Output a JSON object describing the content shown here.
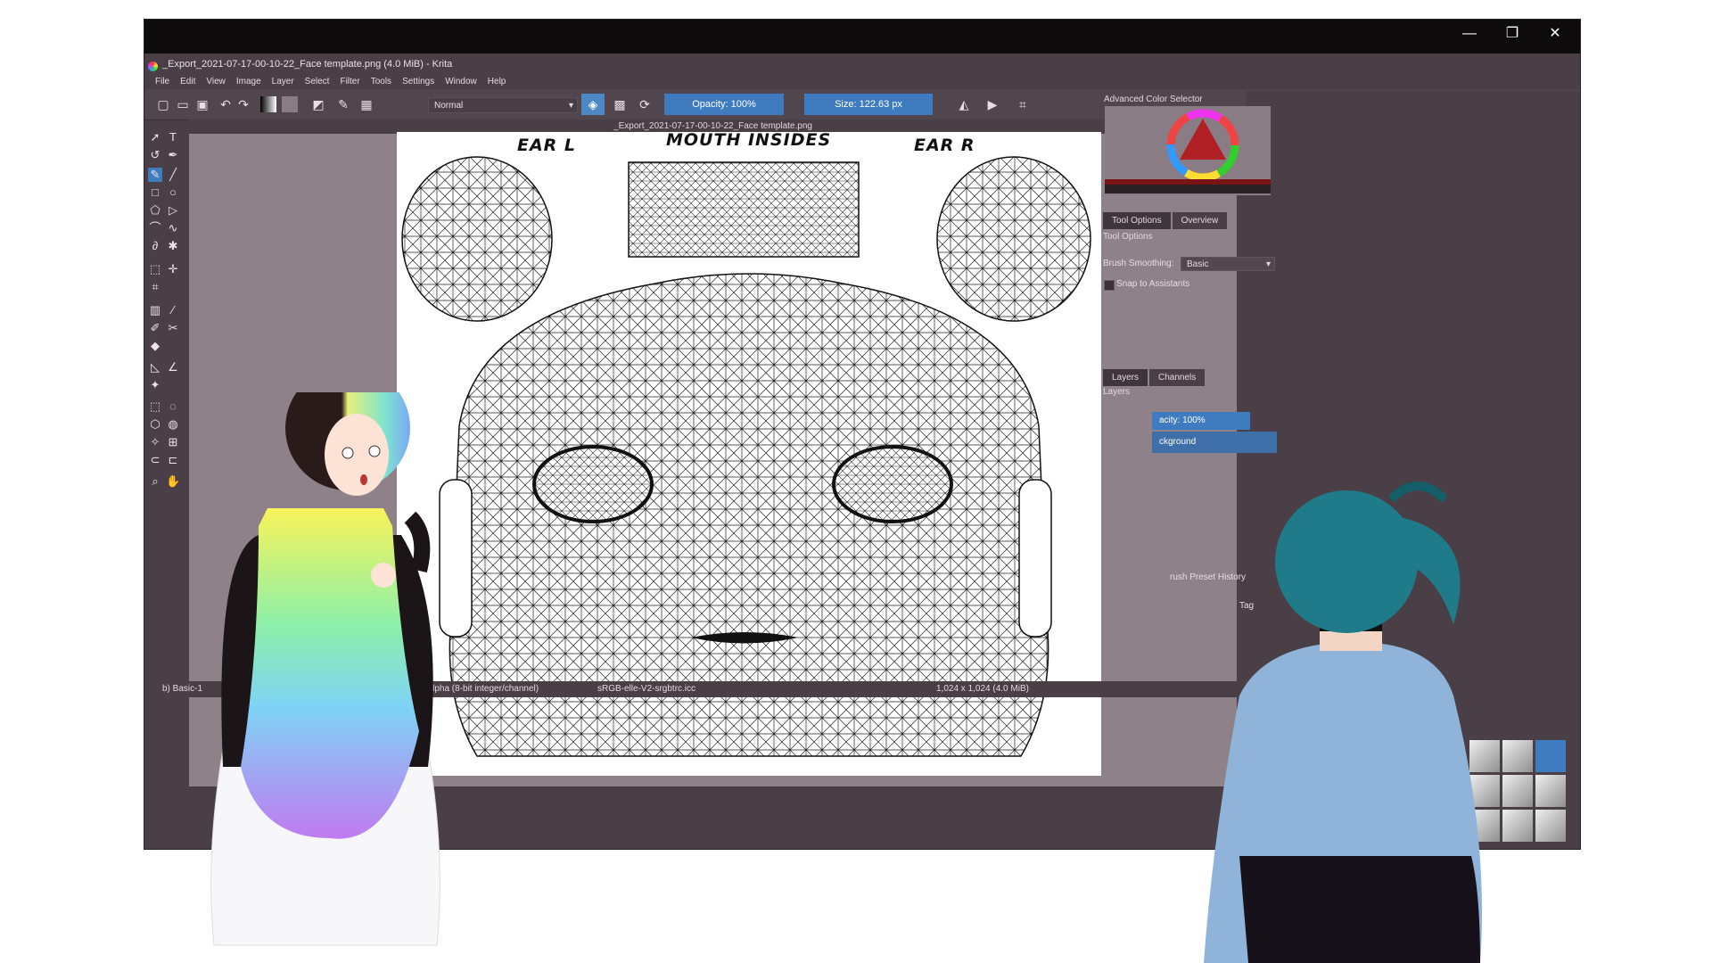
{
  "window": {
    "title": "_Export_2021-07-17-00-10-22_Face template.png (4.0 MiB) - Krita",
    "controls": [
      "—",
      "❐",
      "✕"
    ]
  },
  "menu": [
    "File",
    "Edit",
    "View",
    "Image",
    "Layer",
    "Select",
    "Filter",
    "Tools",
    "Settings",
    "Window",
    "Help"
  ],
  "toolbar": {
    "blend_mode": "Normal",
    "opacity": "Opacity: 100%",
    "size": "Size: 122.63 px"
  },
  "document": {
    "tab_title": "_Export_2021-07-17-00-10-22_Face template.png",
    "labels": [
      "EAR L",
      "MOUTH INSIDES",
      "EAR R"
    ]
  },
  "dock": {
    "color_selector_title": "Advanced Color Selector",
    "tabs_tool": [
      "Tool Options",
      "Overview"
    ],
    "tool_options_title": "Tool Options",
    "brush_smoothing_label": "Brush Smoothing:",
    "brush_smoothing_value": "Basic",
    "snap_label": "Snap to Assistants",
    "tabs_layers": [
      "Layers",
      "Channels"
    ],
    "layers_title": "Layers",
    "layer_opacity": "acity:  100%",
    "layer_name": "ckground",
    "preset_history": "rush Preset History",
    "tag_label": "Tag"
  },
  "status": {
    "brush": "b) Basic-1",
    "color_space": "RGB/Alpha (8-bit integer/channel)",
    "profile": "sRGB-elle-V2-srgbtrc.icc",
    "dimensions": "1,024 x 1,024 (4.0 MiB)"
  },
  "colors": {
    "window_bg": "#4a3f47",
    "accent_blue": "#3f7bbf",
    "canvas_bg": "#8e8189"
  }
}
